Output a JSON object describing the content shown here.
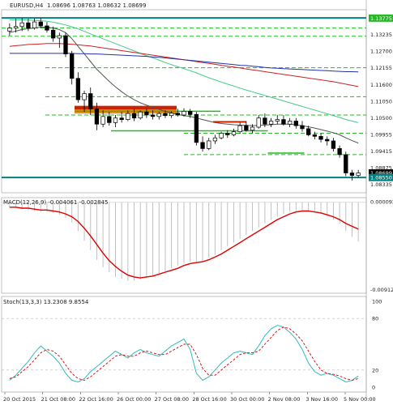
{
  "header": {
    "symbol": "EURUSD,H4",
    "ohlc": "1.08696 1.08763 1.08632 1.08699"
  },
  "macd_label": "MACD(12,26,9) -0.004061 -0.002845",
  "stoch_label": "Stoch(13,3,3) 13.2308 9.8554",
  "colors": {
    "background": "#ffffff",
    "candle_up": "#ffffff",
    "candle_down": "#000000",
    "support_resistance_green": "#22bb22",
    "teal_line": "#008080",
    "ma_black": "#555555",
    "ma_green": "#44cc88",
    "ma_red": "#cc2222",
    "ma_blue": "#2233aa",
    "macd_signal": "#dd0000",
    "macd_hist": "#c0c0c0",
    "stoch_main": "#33bbbb",
    "stoch_signal": "#dd0000",
    "zone_red": "#cc2200",
    "zone_orange": "#ff8800"
  },
  "chart_data": [
    {
      "type": "candlestick",
      "title": "EURUSD,H4",
      "x_tick_labels": [
        "20 Oct 2015",
        "21 Oct 08:00",
        "22 Oct 16:00",
        "26 Oct 00:00",
        "27 Oct 08:00",
        "28 Oct 16:00",
        "30 Oct 00:00",
        "2 Nov 08:00",
        "3 Nov 16:00",
        "5 Nov 00:00"
      ],
      "price_labels": [
        "1.13775",
        "1.13235",
        "1.12700",
        "1.12155",
        "1.11600",
        "1.11050",
        "1.10500",
        "1.09955",
        "1.09415",
        "1.08875",
        "1.08699",
        "1.08550",
        "1.08335"
      ],
      "highlighted_prices": [
        {
          "label": "1.13775",
          "color": "#22bb22"
        },
        {
          "label": "1.08699",
          "color": "#000000"
        },
        {
          "label": "1.08550",
          "color": "#008080"
        }
      ],
      "ylim": [
        1.0805,
        1.1405
      ],
      "candles": [
        {
          "o": 1.1335,
          "h": 1.136,
          "l": 1.132,
          "c": 1.1345
        },
        {
          "o": 1.1345,
          "h": 1.1375,
          "l": 1.133,
          "c": 1.135
        },
        {
          "o": 1.135,
          "h": 1.1378,
          "l": 1.1335,
          "c": 1.1362
        },
        {
          "o": 1.1362,
          "h": 1.1375,
          "l": 1.1335,
          "c": 1.1345
        },
        {
          "o": 1.1345,
          "h": 1.1376,
          "l": 1.134,
          "c": 1.1365
        },
        {
          "o": 1.1365,
          "h": 1.1378,
          "l": 1.1345,
          "c": 1.1352
        },
        {
          "o": 1.1352,
          "h": 1.1365,
          "l": 1.133,
          "c": 1.1338
        },
        {
          "o": 1.1338,
          "h": 1.135,
          "l": 1.13,
          "c": 1.1312
        },
        {
          "o": 1.1312,
          "h": 1.133,
          "l": 1.128,
          "c": 1.132
        },
        {
          "o": 1.132,
          "h": 1.133,
          "l": 1.125,
          "c": 1.126
        },
        {
          "o": 1.126,
          "h": 1.127,
          "l": 1.116,
          "c": 1.118
        },
        {
          "o": 1.118,
          "h": 1.12,
          "l": 1.11,
          "c": 1.111
        },
        {
          "o": 1.111,
          "h": 1.114,
          "l": 1.107,
          "c": 1.113
        },
        {
          "o": 1.113,
          "h": 1.115,
          "l": 1.106,
          "c": 1.108
        },
        {
          "o": 1.108,
          "h": 1.11,
          "l": 1.101,
          "c": 1.103
        },
        {
          "o": 1.103,
          "h": 1.1075,
          "l": 1.102,
          "c": 1.1055
        },
        {
          "o": 1.1055,
          "h": 1.107,
          "l": 1.1025,
          "c": 1.1035
        },
        {
          "o": 1.1035,
          "h": 1.106,
          "l": 1.102,
          "c": 1.105
        },
        {
          "o": 1.105,
          "h": 1.107,
          "l": 1.1035,
          "c": 1.1045
        },
        {
          "o": 1.1045,
          "h": 1.1075,
          "l": 1.104,
          "c": 1.1065
        },
        {
          "o": 1.1065,
          "h": 1.108,
          "l": 1.104,
          "c": 1.105
        },
        {
          "o": 1.105,
          "h": 1.1075,
          "l": 1.1045,
          "c": 1.107
        },
        {
          "o": 1.107,
          "h": 1.108,
          "l": 1.105,
          "c": 1.106
        },
        {
          "o": 1.106,
          "h": 1.1075,
          "l": 1.1045,
          "c": 1.1055
        },
        {
          "o": 1.1055,
          "h": 1.107,
          "l": 1.1045,
          "c": 1.1065
        },
        {
          "o": 1.1065,
          "h": 1.1075,
          "l": 1.105,
          "c": 1.1058
        },
        {
          "o": 1.1058,
          "h": 1.1072,
          "l": 1.105,
          "c": 1.1066
        },
        {
          "o": 1.1066,
          "h": 1.108,
          "l": 1.1055,
          "c": 1.106
        },
        {
          "o": 1.106,
          "h": 1.1082,
          "l": 1.1055,
          "c": 1.1072
        },
        {
          "o": 1.1072,
          "h": 1.108,
          "l": 1.105,
          "c": 1.1062
        },
        {
          "o": 1.1062,
          "h": 1.107,
          "l": 1.096,
          "c": 1.097
        },
        {
          "o": 1.097,
          "h": 1.099,
          "l": 1.094,
          "c": 1.095
        },
        {
          "o": 1.095,
          "h": 1.0985,
          "l": 1.0945,
          "c": 1.0975
        },
        {
          "o": 1.0975,
          "h": 1.0995,
          "l": 1.0965,
          "c": 1.0985
        },
        {
          "o": 1.0985,
          "h": 1.1005,
          "l": 1.098,
          "c": 1.1
        },
        {
          "o": 1.1,
          "h": 1.101,
          "l": 1.0985,
          "c": 1.0995
        },
        {
          "o": 1.0995,
          "h": 1.1015,
          "l": 1.099,
          "c": 1.1005
        },
        {
          "o": 1.1005,
          "h": 1.1035,
          "l": 1.0998,
          "c": 1.1025
        },
        {
          "o": 1.1025,
          "h": 1.104,
          "l": 1.1005,
          "c": 1.101
        },
        {
          "o": 1.101,
          "h": 1.103,
          "l": 1.1,
          "c": 1.102
        },
        {
          "o": 1.102,
          "h": 1.106,
          "l": 1.1015,
          "c": 1.105
        },
        {
          "o": 1.105,
          "h": 1.1065,
          "l": 1.102,
          "c": 1.103
        },
        {
          "o": 1.103,
          "h": 1.105,
          "l": 1.102,
          "c": 1.104
        },
        {
          "o": 1.104,
          "h": 1.106,
          "l": 1.103,
          "c": 1.1045
        },
        {
          "o": 1.1045,
          "h": 1.106,
          "l": 1.1025,
          "c": 1.103
        },
        {
          "o": 1.103,
          "h": 1.105,
          "l": 1.102,
          "c": 1.104
        },
        {
          "o": 1.104,
          "h": 1.105,
          "l": 1.1015,
          "c": 1.1025
        },
        {
          "o": 1.1025,
          "h": 1.104,
          "l": 1.1005,
          "c": 1.1015
        },
        {
          "o": 1.1015,
          "h": 1.1025,
          "l": 1.099,
          "c": 1.0995
        },
        {
          "o": 1.0995,
          "h": 1.1005,
          "l": 1.098,
          "c": 1.099
        },
        {
          "o": 1.099,
          "h": 1.1,
          "l": 1.097,
          "c": 1.098
        },
        {
          "o": 1.098,
          "h": 1.099,
          "l": 1.096,
          "c": 1.0975
        },
        {
          "o": 1.0975,
          "h": 1.0985,
          "l": 1.094,
          "c": 1.095
        },
        {
          "o": 1.095,
          "h": 1.096,
          "l": 1.092,
          "c": 1.093
        },
        {
          "o": 1.093,
          "h": 1.094,
          "l": 1.086,
          "c": 1.087
        },
        {
          "o": 1.087,
          "h": 1.088,
          "l": 1.0845,
          "c": 1.0862
        },
        {
          "o": 1.0862,
          "h": 1.088,
          "l": 1.0855,
          "c": 1.087
        }
      ],
      "moving_averages": [
        {
          "color": "#555555",
          "values": [
            1.133,
            1.1335,
            1.134,
            1.1343,
            1.1345,
            1.1348,
            1.1348,
            1.1345,
            1.134,
            1.133,
            1.131,
            1.1285,
            1.126,
            1.1235,
            1.121,
            1.119,
            1.117,
            1.1152,
            1.1136,
            1.1122,
            1.111,
            1.11,
            1.1092,
            1.1085,
            1.1078,
            1.1072,
            1.1066,
            1.1062,
            1.1058,
            1.1055,
            1.105,
            1.1045,
            1.104,
            1.1035,
            1.1032,
            1.103,
            1.1028,
            1.1027,
            1.1026,
            1.1025,
            1.1026,
            1.1027,
            1.1028,
            1.103,
            1.103,
            1.103,
            1.1028,
            1.1025,
            1.1021,
            1.1017,
            1.1012,
            1.1007,
            1.1002,
            1.0995,
            1.0985,
            1.0976,
            1.0968
          ]
        },
        {
          "color": "#44cc88",
          "values": [
            1.1372,
            1.1372,
            1.1372,
            1.1371,
            1.137,
            1.1369,
            1.1367,
            1.1364,
            1.136,
            1.1355,
            1.1349,
            1.1342,
            1.1334,
            1.1326,
            1.1318,
            1.131,
            1.1302,
            1.1294,
            1.1286,
            1.1278,
            1.127,
            1.1262,
            1.1254,
            1.1247,
            1.124,
            1.1232,
            1.1225,
            1.1218,
            1.1212,
            1.1205,
            1.1198,
            1.119,
            1.1182,
            1.1175,
            1.1168,
            1.1161,
            1.1155,
            1.1148,
            1.1142,
            1.1136,
            1.113,
            1.1124,
            1.1118,
            1.1112,
            1.1106,
            1.11,
            1.1094,
            1.1088,
            1.1082,
            1.1076,
            1.107,
            1.1064,
            1.1058,
            1.1052,
            1.1045,
            1.104,
            1.1035
          ]
        },
        {
          "color": "#cc2222",
          "values": [
            1.1285,
            1.1287,
            1.1289,
            1.1291,
            1.1292,
            1.1293,
            1.1294,
            1.1294,
            1.1294,
            1.1293,
            1.1292,
            1.129,
            1.1288,
            1.1286,
            1.1283,
            1.128,
            1.1277,
            1.1274,
            1.1271,
            1.1268,
            1.1265,
            1.1262,
            1.1259,
            1.1256,
            1.1253,
            1.125,
            1.1247,
            1.1244,
            1.1241,
            1.1238,
            1.1235,
            1.1232,
            1.1229,
            1.1226,
            1.1223,
            1.122,
            1.1217,
            1.1214,
            1.1211,
            1.1208,
            1.1205,
            1.1202,
            1.1199,
            1.1196,
            1.1193,
            1.119,
            1.1187,
            1.1184,
            1.1181,
            1.1178,
            1.1175,
            1.1172,
            1.1169,
            1.1165,
            1.1161,
            1.1157,
            1.1153
          ]
        },
        {
          "color": "#2233aa",
          "values": [
            1.1262,
            1.1262,
            1.1262,
            1.1262,
            1.1262,
            1.1262,
            1.1262,
            1.1262,
            1.1262,
            1.1262,
            1.1262,
            1.1261,
            1.1261,
            1.126,
            1.126,
            1.1259,
            1.1258,
            1.1257,
            1.1256,
            1.1255,
            1.1254,
            1.1253,
            1.1252,
            1.125,
            1.1249,
            1.1247,
            1.1245,
            1.1243,
            1.1241,
            1.1239,
            1.1237,
            1.1235,
            1.1233,
            1.1231,
            1.1229,
            1.1227,
            1.1225,
            1.1223,
            1.1222,
            1.122,
            1.1218,
            1.1216,
            1.1214,
            1.1213,
            1.1212,
            1.1211,
            1.121,
            1.1209,
            1.1208,
            1.1207,
            1.1206,
            1.1205,
            1.1204,
            1.1203,
            1.1202,
            1.1202,
            1.1201
          ]
        }
      ],
      "horizontal_levels": [
        {
          "price": 1.1378,
          "color": "#008080",
          "style": "solid",
          "width": 2,
          "from": 0,
          "to": 1
        },
        {
          "price": 1.0855,
          "color": "#008080",
          "style": "solid",
          "width": 2,
          "from": 0,
          "to": 1
        },
        {
          "price": 1.1345,
          "color": "#22bb22",
          "style": "dashed",
          "width": 1,
          "from": 0,
          "to": 1
        },
        {
          "price": 1.1318,
          "color": "#22bb22",
          "style": "dashed",
          "width": 1,
          "from": 0,
          "to": 1
        },
        {
          "price": 1.1215,
          "color": "#22bb22",
          "style": "dashed",
          "width": 1,
          "from": 0.12,
          "to": 1
        },
        {
          "price": 1.112,
          "color": "#22bb22",
          "style": "dashed",
          "width": 1,
          "from": 0.12,
          "to": 1
        },
        {
          "price": 1.106,
          "color": "#22bb22",
          "style": "dashed",
          "width": 1,
          "from": 0.12,
          "to": 1
        },
        {
          "price": 1.1,
          "color": "#22bb22",
          "style": "dashed",
          "width": 1,
          "from": 0.5,
          "to": 1
        },
        {
          "price": 1.093,
          "color": "#22bb22",
          "style": "dashed",
          "width": 1,
          "from": 0.5,
          "to": 1
        },
        {
          "price": 1.1072,
          "color": "#22bb22",
          "style": "solid",
          "width": 1.5,
          "from": 0.2,
          "to": 0.6
        },
        {
          "price": 1.1008,
          "color": "#22bb22",
          "style": "solid",
          "width": 1.5,
          "from": 0.3,
          "to": 0.73
        },
        {
          "price": 1.0935,
          "color": "#22bb22",
          "style": "solid",
          "width": 1.5,
          "from": 0.73,
          "to": 0.83
        }
      ],
      "zones": [
        {
          "price_high": 1.109,
          "price_low": 1.1065,
          "color": "#cc2200",
          "from": 0.2,
          "to": 0.48
        },
        {
          "price_high": 1.1078,
          "price_low": 1.1065,
          "color": "#ff8800",
          "from": 0.2,
          "to": 0.48
        },
        {
          "price_high": 1.104,
          "price_low": 1.1035,
          "color": "#cc2200",
          "from": 0.58,
          "to": 0.67
        }
      ]
    },
    {
      "type": "bar",
      "title": "MACD(12,26,9) -0.004061 -0.002845",
      "tick_labels": [
        "0.000092",
        "-0.009125"
      ],
      "ylim": [
        -0.0095,
        0.0005
      ],
      "histogram": [
        -0.0005,
        -0.0006,
        -0.0007,
        -0.0008,
        -0.0009,
        -0.001,
        -0.001,
        -0.0011,
        -0.0013,
        -0.0016,
        -0.0021,
        -0.003,
        -0.004,
        -0.005,
        -0.006,
        -0.0068,
        -0.0073,
        -0.0078,
        -0.008,
        -0.0082,
        -0.0082,
        -0.0081,
        -0.0079,
        -0.0077,
        -0.0074,
        -0.0072,
        -0.0069,
        -0.0066,
        -0.0064,
        -0.0062,
        -0.0062,
        -0.0061,
        -0.0058,
        -0.0055,
        -0.005,
        -0.0046,
        -0.0042,
        -0.0038,
        -0.0034,
        -0.003,
        -0.0026,
        -0.0022,
        -0.0018,
        -0.0015,
        -0.0012,
        -0.001,
        -0.0009,
        -0.0008,
        -0.0009,
        -0.001,
        -0.0012,
        -0.0015,
        -0.0018,
        -0.0022,
        -0.003,
        -0.0036,
        -0.0041
      ],
      "signal": [
        -0.0005,
        -0.0005,
        -0.0006,
        -0.0006,
        -0.0007,
        -0.0008,
        -0.0008,
        -0.0009,
        -0.001,
        -0.0012,
        -0.0015,
        -0.002,
        -0.0027,
        -0.0035,
        -0.0044,
        -0.0053,
        -0.0061,
        -0.0067,
        -0.0072,
        -0.0076,
        -0.0078,
        -0.0079,
        -0.0078,
        -0.0077,
        -0.0075,
        -0.0073,
        -0.0071,
        -0.0069,
        -0.0066,
        -0.0064,
        -0.0063,
        -0.0062,
        -0.006,
        -0.0057,
        -0.0054,
        -0.005,
        -0.0046,
        -0.0042,
        -0.0038,
        -0.0034,
        -0.003,
        -0.0026,
        -0.0022,
        -0.0018,
        -0.0015,
        -0.0012,
        -0.001,
        -0.0009,
        -0.0009,
        -0.001,
        -0.0011,
        -0.0013,
        -0.0015,
        -0.0018,
        -0.0022,
        -0.0025,
        -0.0028
      ]
    },
    {
      "type": "line",
      "title": "Stoch(13,3,3) 13.2308 9.8554",
      "tick_labels": [
        "100",
        "80",
        "20",
        "0"
      ],
      "ylim": [
        0,
        100
      ],
      "main": [
        8,
        14,
        22,
        30,
        40,
        48,
        42,
        36,
        28,
        16,
        8,
        6,
        10,
        18,
        24,
        30,
        36,
        42,
        38,
        34,
        40,
        44,
        40,
        38,
        36,
        42,
        48,
        52,
        56,
        44,
        16,
        8,
        12,
        20,
        28,
        34,
        40,
        42,
        40,
        38,
        48,
        60,
        68,
        72,
        70,
        64,
        56,
        44,
        28,
        18,
        14,
        16,
        14,
        10,
        6,
        8,
        13
      ],
      "signal": [
        10,
        12,
        18,
        24,
        32,
        40,
        44,
        42,
        36,
        26,
        16,
        10,
        8,
        12,
        18,
        24,
        30,
        36,
        38,
        36,
        36,
        40,
        42,
        40,
        38,
        38,
        42,
        46,
        50,
        50,
        38,
        22,
        14,
        14,
        20,
        26,
        32,
        38,
        40,
        40,
        42,
        50,
        58,
        66,
        70,
        68,
        62,
        54,
        42,
        30,
        20,
        16,
        15,
        13,
        10,
        8,
        10
      ]
    }
  ]
}
